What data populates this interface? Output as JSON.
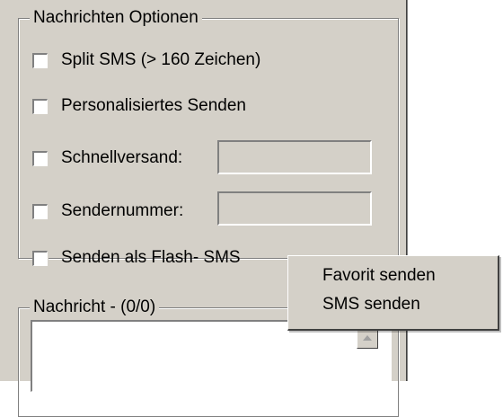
{
  "options_group": {
    "title": "Nachrichten Optionen",
    "split_sms": {
      "label": "Split SMS (> 160 Zeichen)",
      "checked": false
    },
    "personalized": {
      "label": "Personalisiertes Senden",
      "checked": false
    },
    "fast_send": {
      "label": "Schnellversand:",
      "checked": false,
      "value": ""
    },
    "sender_number": {
      "label": "Sendernummer:",
      "checked": false,
      "value": ""
    },
    "flash_sms": {
      "label": "Senden als Flash- SMS",
      "checked": false
    }
  },
  "message_group": {
    "title": "Nachricht - (0/0)",
    "text": ""
  },
  "context_menu": {
    "items": [
      {
        "label": "Favorit senden"
      },
      {
        "label": "SMS senden"
      }
    ]
  },
  "icons": {
    "scroll_up": "arrow-up-icon"
  }
}
